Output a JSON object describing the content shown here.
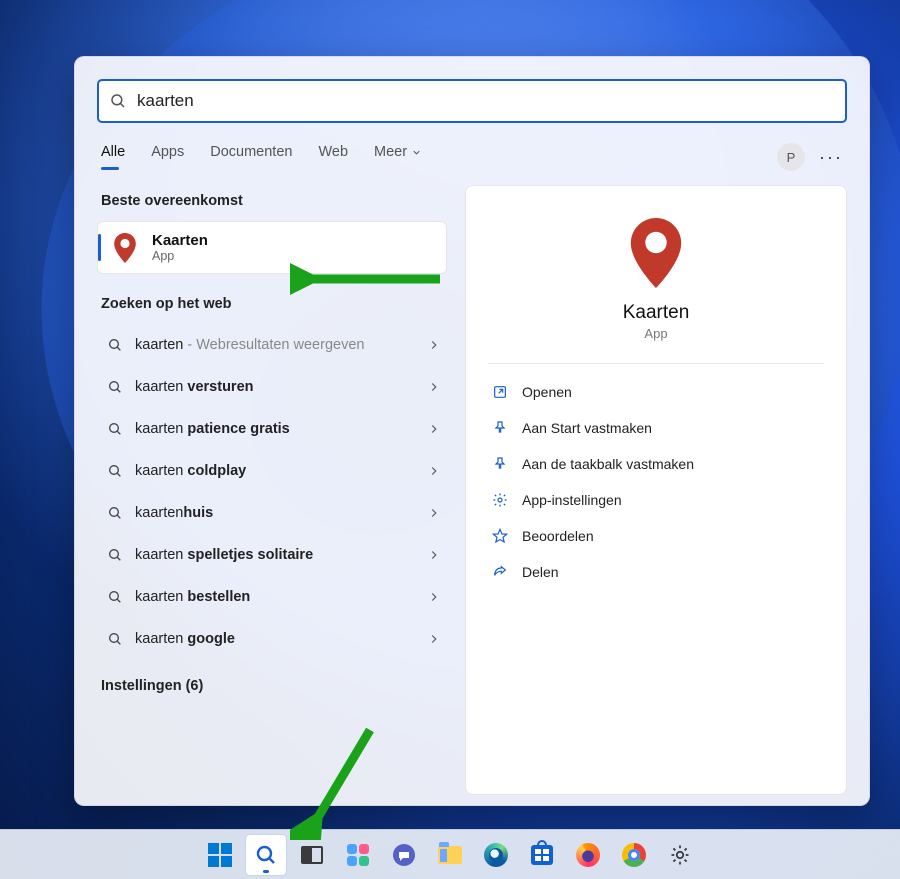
{
  "search": {
    "value": "kaarten",
    "placeholder": ""
  },
  "tabs": {
    "alle": "Alle",
    "apps": "Apps",
    "documenten": "Documenten",
    "web": "Web",
    "meer": "Meer"
  },
  "avatar_initial": "P",
  "sections": {
    "best_match": "Beste overeenkomst",
    "search_web": "Zoeken op het web",
    "settings": "Instellingen (6)"
  },
  "best_match": {
    "title": "Kaarten",
    "subtitle": "App"
  },
  "web_results": [
    {
      "prefix": "kaarten",
      "bold": "",
      "suffix": " - Webresultaten weergeven",
      "suffix_muted": true
    },
    {
      "prefix": "kaarten ",
      "bold": "versturen",
      "suffix": ""
    },
    {
      "prefix": "kaarten ",
      "bold": "patience gratis",
      "suffix": ""
    },
    {
      "prefix": "kaarten ",
      "bold": "coldplay",
      "suffix": ""
    },
    {
      "prefix": "kaarten",
      "bold": "huis",
      "suffix": ""
    },
    {
      "prefix": "kaarten ",
      "bold": "spelletjes solitaire",
      "suffix": ""
    },
    {
      "prefix": "kaarten ",
      "bold": "bestellen",
      "suffix": ""
    },
    {
      "prefix": "kaarten ",
      "bold": "google",
      "suffix": ""
    }
  ],
  "detail": {
    "title": "Kaarten",
    "subtitle": "App",
    "actions": {
      "open": "Openen",
      "pin_start": "Aan Start vastmaken",
      "pin_taskbar": "Aan de taakbalk vastmaken",
      "app_settings": "App-instellingen",
      "review": "Beoordelen",
      "share": "Delen"
    }
  },
  "taskbar": {
    "start": "start",
    "search": "search",
    "taskview": "task-view",
    "widgets": "widgets",
    "chat": "chat",
    "explorer": "file-explorer",
    "edge": "edge",
    "store": "microsoft-store",
    "firefox": "firefox",
    "chrome": "chrome",
    "settings": "settings"
  }
}
